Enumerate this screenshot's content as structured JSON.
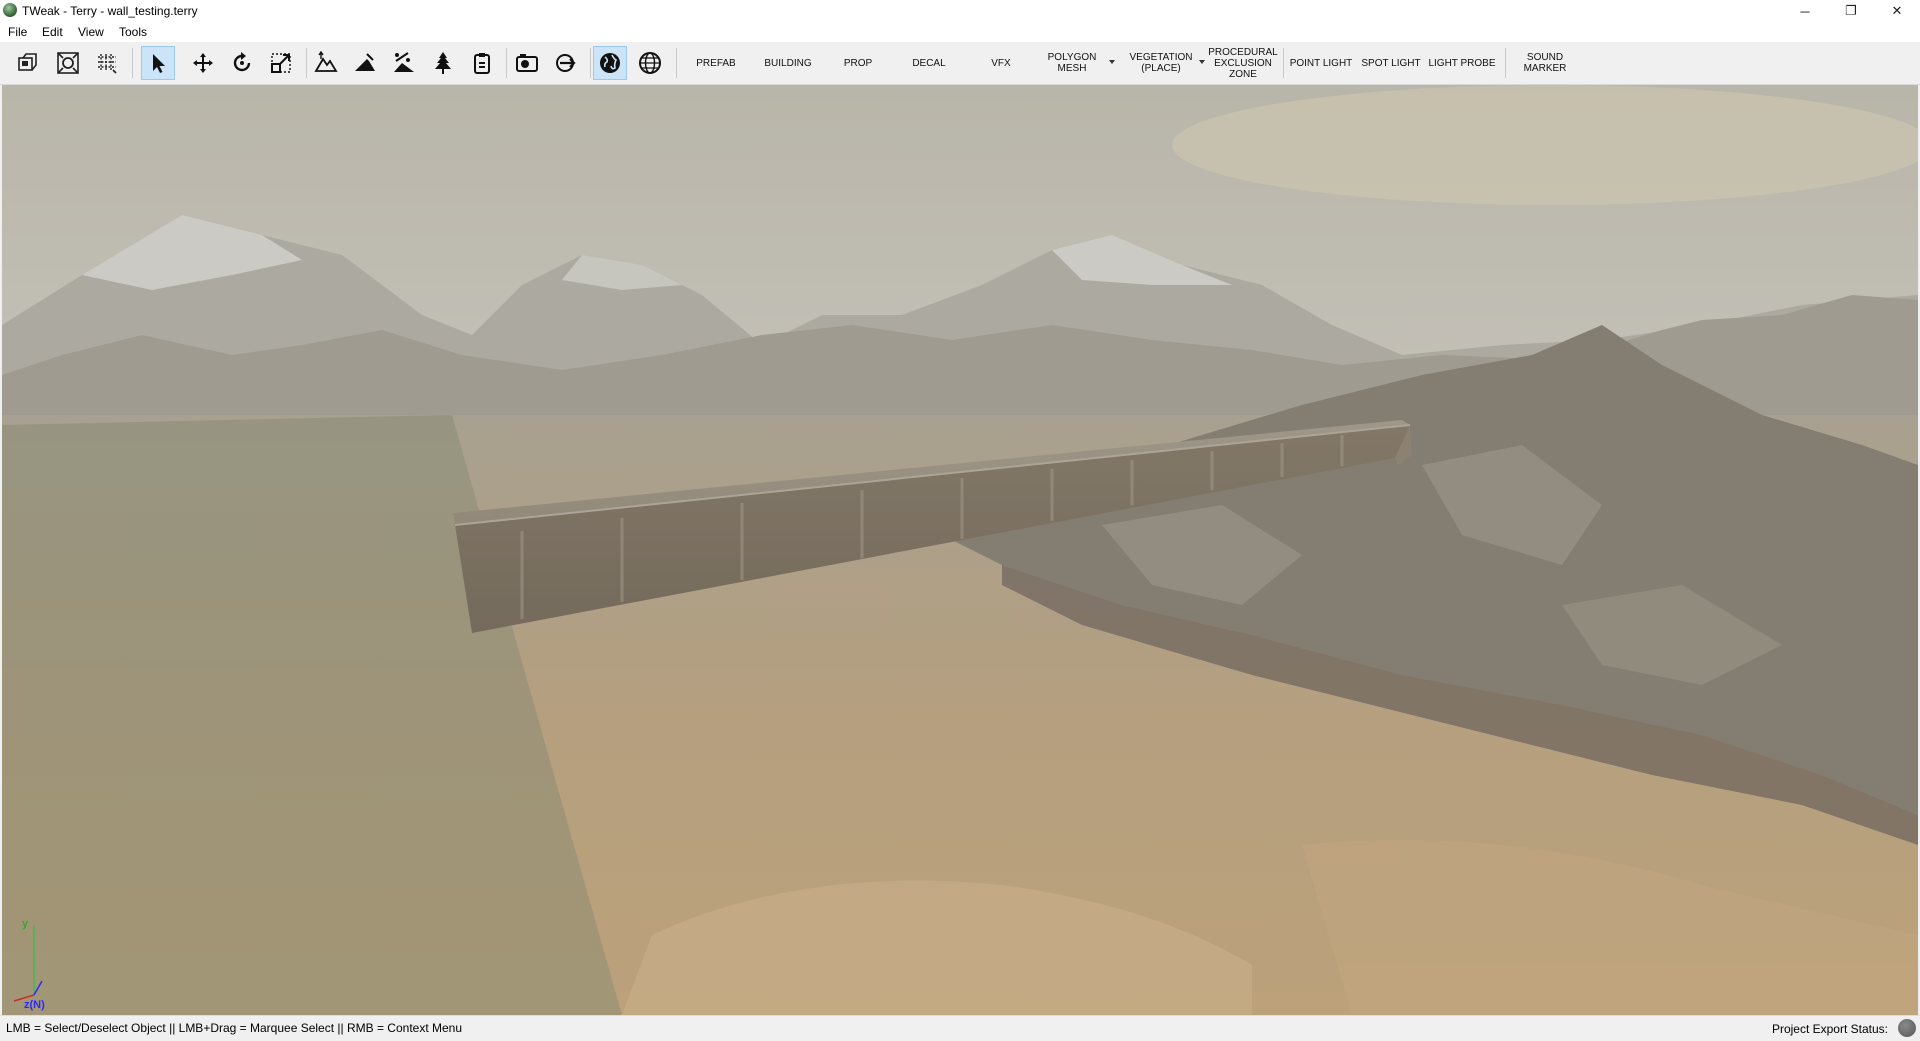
{
  "window": {
    "title": "TWeak - Terry - wall_testing.terry",
    "controls": {
      "minimize": "─",
      "restore": "❐",
      "close": "✕"
    }
  },
  "menu": [
    "File",
    "Edit",
    "View",
    "Tools"
  ],
  "toolbar": {
    "icon_buttons": [
      "camera-view-icon",
      "zoom-extents-icon",
      "grid-toggle-icon",
      "select-tool-icon",
      "move-tool-icon",
      "rotate-tool-icon",
      "scale-tool-icon",
      "terrain-raise-icon",
      "terrain-flatten-icon",
      "terrain-smooth-icon",
      "tree-paint-icon",
      "clipboard-icon",
      "camera-capture-icon",
      "export-arrow-icon",
      "world-view-icon",
      "grid-sphere-icon"
    ],
    "active_buttons": [
      "select-tool-icon",
      "world-view-icon"
    ],
    "place_buttons": [
      "PREFAB",
      "BUILDING",
      "PROP",
      "DECAL",
      "VFX",
      "POLYGON\nMESH",
      "VEGETATION\n(PLACE)",
      "PROCEDURAL\nEXCLUSION\nZONE",
      "POINT LIGHT",
      "SPOT LIGHT",
      "LIGHT PROBE",
      "SOUND\nMARKER"
    ]
  },
  "viewport": {
    "axis_y_label": "y",
    "axis_z_label": "z(N)"
  },
  "status": {
    "hint": "LMB = Select/Deselect Object || LMB+Drag = Marquee Select || RMB = Context Menu",
    "export_label": "Project Export Status:"
  }
}
